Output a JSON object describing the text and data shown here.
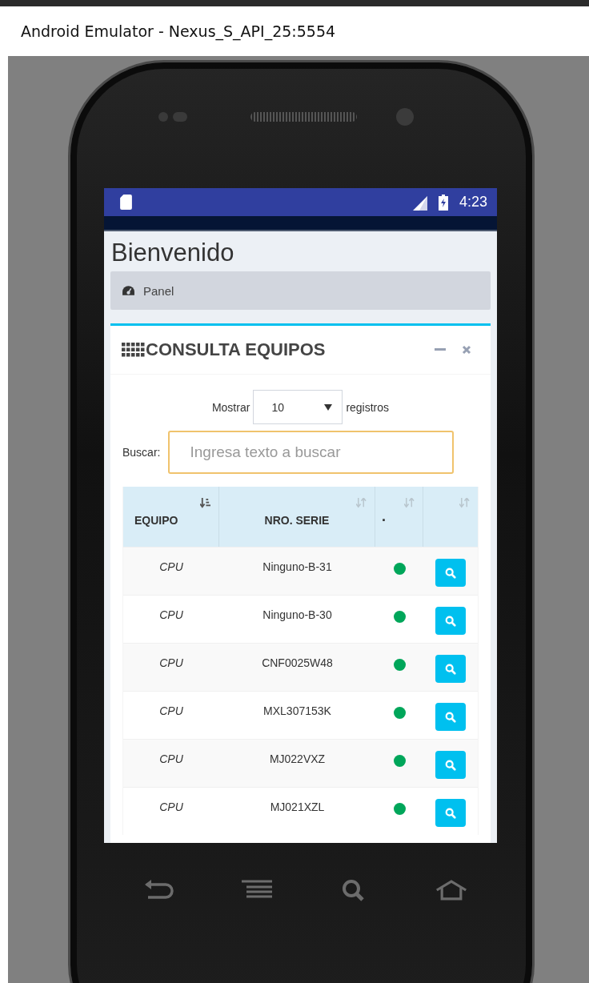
{
  "window": {
    "title": "Android Emulator - Nexus_S_API_25:5554"
  },
  "status_bar": {
    "time": "4:23"
  },
  "page": {
    "title": "Bienvenido",
    "breadcrumb": "Panel"
  },
  "box": {
    "title": "CONSULTA EQUIPOS",
    "length": {
      "before": "Mostrar",
      "value": "10",
      "after": "registros"
    },
    "search": {
      "label": "Buscar:",
      "placeholder": "Ingresa texto a buscar"
    }
  },
  "table": {
    "columns": [
      {
        "label": "EQUIPO",
        "sorted": true
      },
      {
        "label": "NRO. SERIE",
        "sorted": false
      },
      {
        "label": ".",
        "sorted": false
      },
      {
        "sorted": false
      }
    ],
    "rows": [
      {
        "equipo": "CPU",
        "serie": "Ninguno-B-31",
        "color": "#00a65a"
      },
      {
        "equipo": "CPU",
        "serie": "Ninguno-B-30",
        "color": "#00a65a"
      },
      {
        "equipo": "CPU",
        "serie": "CNF0025W48",
        "color": "#00a65a"
      },
      {
        "equipo": "CPU",
        "serie": "MXL307153K",
        "color": "#00a65a"
      },
      {
        "equipo": "CPU",
        "serie": "MJ022VXZ",
        "color": "#00a65a"
      },
      {
        "equipo": "CPU",
        "serie": "MJ021XZL",
        "color": "#00a65a"
      }
    ]
  }
}
